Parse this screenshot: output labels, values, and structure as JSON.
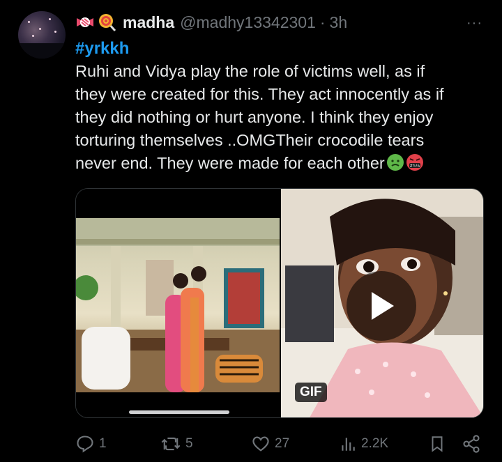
{
  "tweet": {
    "display_name": "madha",
    "handle": "@madhy13342301",
    "separator": "·",
    "time": "3h",
    "more": "···",
    "hashtag": "#yrkkh",
    "text_lines": [
      "Ruhi and Vidya play the role of victims well, as if",
      "they were created for this. They act innocently as if",
      "they did nothing or hurt anyone. I think they enjoy",
      "torturing themselves ..OMGTheir crocodile tears",
      "never end. They were made for each other"
    ],
    "name_emojis": [
      "candy-icon",
      "lollipop-icon"
    ],
    "text_emojis": [
      "nauseated-face-icon",
      "face-with-symbols-icon"
    ],
    "face_symbols": "#%!&"
  },
  "media": {
    "gif_label": "GIF"
  },
  "actions": {
    "replies": "1",
    "reposts": "5",
    "likes": "27",
    "views": "2.2K"
  },
  "colors": {
    "background": "#000000",
    "text": "#e7e9ea",
    "muted": "#71767b",
    "accent": "#1d9bf0"
  }
}
